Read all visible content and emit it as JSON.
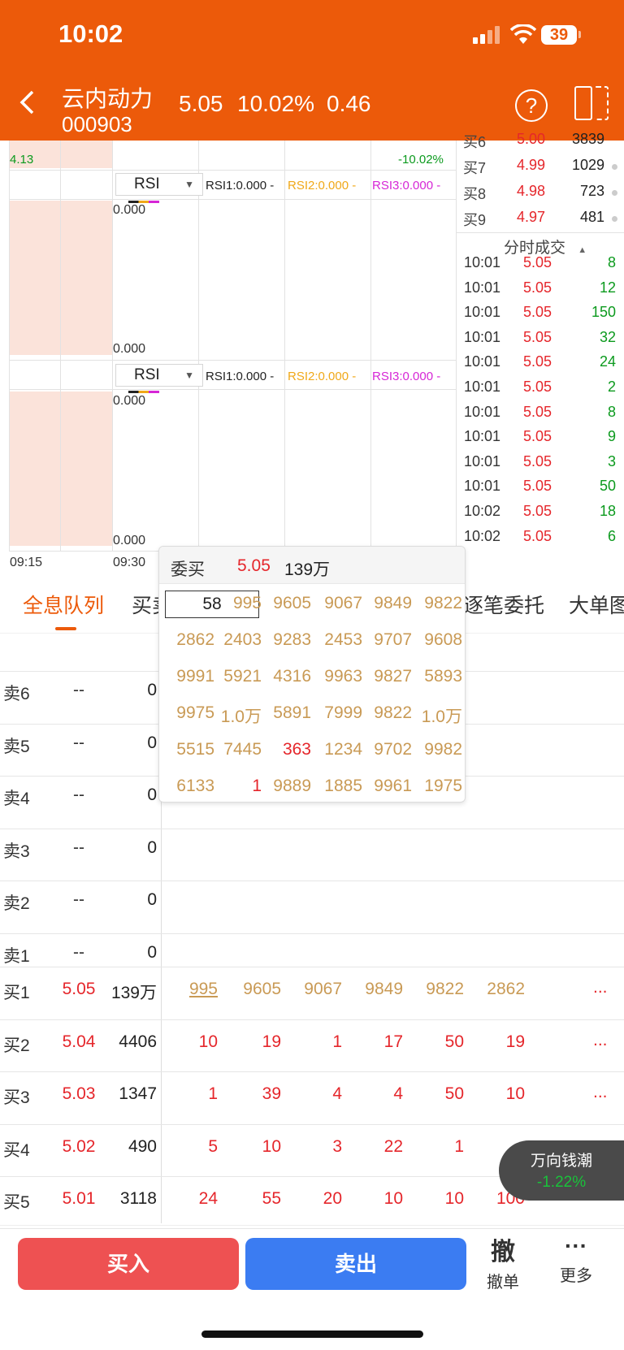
{
  "status_bar": {
    "time": "10:02",
    "battery": "39"
  },
  "header": {
    "stock_name": "云内动力",
    "stock_code": "000903",
    "price": "5.05",
    "change_pct": "10.02%",
    "change": "0.46",
    "help_icon": "?"
  },
  "chart": {
    "top_left_value": "4.13",
    "top_right_value": "-10.02%",
    "rsi_select": "RSI",
    "rsi_labels": {
      "rsi1": "RSI1:0.000 -",
      "rsi2": "RSI2:0.000 -",
      "rsi3": "RSI3:0.000 -"
    },
    "axis_top": "0.000",
    "axis_bottom": "0.000",
    "time_start": "09:15",
    "time_mid": "09:30",
    "colors": {
      "rsi1": "#222222",
      "rsi2": "#f0a818",
      "rsi3": "#d626d6"
    }
  },
  "order_book_partial": [
    {
      "label": "买6",
      "price": "5.00",
      "volume": "3839"
    },
    {
      "label": "买7",
      "price": "4.99",
      "volume": "1029"
    },
    {
      "label": "买8",
      "price": "4.98",
      "volume": "723"
    },
    {
      "label": "买9",
      "price": "4.97",
      "volume": "481"
    }
  ],
  "trades": {
    "title": "分时成交",
    "rows": [
      {
        "time": "10:01",
        "price": "5.05",
        "vol": "8"
      },
      {
        "time": "10:01",
        "price": "5.05",
        "vol": "12"
      },
      {
        "time": "10:01",
        "price": "5.05",
        "vol": "150"
      },
      {
        "time": "10:01",
        "price": "5.05",
        "vol": "32"
      },
      {
        "time": "10:01",
        "price": "5.05",
        "vol": "24"
      },
      {
        "time": "10:01",
        "price": "5.05",
        "vol": "2"
      },
      {
        "time": "10:01",
        "price": "5.05",
        "vol": "8"
      },
      {
        "time": "10:01",
        "price": "5.05",
        "vol": "9"
      },
      {
        "time": "10:01",
        "price": "5.05",
        "vol": "3"
      },
      {
        "time": "10:01",
        "price": "5.05",
        "vol": "50"
      },
      {
        "time": "10:02",
        "price": "5.05",
        "vol": "18"
      },
      {
        "time": "10:02",
        "price": "5.05",
        "vol": "6"
      }
    ]
  },
  "tabs": {
    "full_queue": "全息队列",
    "buy_partial": "买卖",
    "tick_orders": "逐笔委托",
    "big_orders": "大单图"
  },
  "sell_rows": [
    {
      "label": "卖6",
      "price": "--",
      "volume": "0"
    },
    {
      "label": "卖5",
      "price": "--",
      "volume": "0"
    },
    {
      "label": "卖4",
      "price": "--",
      "volume": "0"
    },
    {
      "label": "卖3",
      "price": "--",
      "volume": "0"
    },
    {
      "label": "卖2",
      "price": "--",
      "volume": "0"
    },
    {
      "label": "卖1",
      "price": "--",
      "volume": "0"
    }
  ],
  "buy_rows": [
    {
      "label": "买1",
      "price": "5.05",
      "volume": "139万",
      "queue": [
        "995",
        "9605",
        "9067",
        "9849",
        "9822",
        "2862"
      ],
      "more": "..."
    },
    {
      "label": "买2",
      "price": "5.04",
      "volume": "4406",
      "queue": [
        "10",
        "19",
        "1",
        "17",
        "50",
        "19"
      ],
      "more": "..."
    },
    {
      "label": "买3",
      "price": "5.03",
      "volume": "1347",
      "queue": [
        "1",
        "39",
        "4",
        "4",
        "50",
        "10"
      ],
      "more": "..."
    },
    {
      "label": "买4",
      "price": "5.02",
      "volume": "490",
      "queue": [
        "5",
        "10",
        "3",
        "22",
        "1",
        ""
      ],
      "more": ""
    },
    {
      "label": "买5",
      "price": "5.01",
      "volume": "3118",
      "queue": [
        "24",
        "55",
        "20",
        "10",
        "10",
        "100"
      ],
      "more": ""
    }
  ],
  "popup": {
    "title": "委买",
    "price": "5.05",
    "volume": "139万",
    "input_value": "58",
    "grid": [
      [
        "",
        "995",
        "9605",
        "9067",
        "9849",
        "9822"
      ],
      [
        "2862",
        "2403",
        "9283",
        "2453",
        "9707",
        "9608"
      ],
      [
        "9991",
        "5921",
        "4316",
        "9963",
        "9827",
        "5893"
      ],
      [
        "9975",
        "1.0万",
        "5891",
        "7999",
        "9822",
        "1.0万"
      ],
      [
        "5515",
        "7445",
        "363",
        "1234",
        "9702",
        "9982"
      ],
      [
        "6133",
        "1",
        "9889",
        "1885",
        "9961",
        "1975"
      ]
    ]
  },
  "float_badge": {
    "name": "万向钱潮",
    "change": "-1.22%"
  },
  "bottom": {
    "buy": "买入",
    "sell": "卖出",
    "cancel_icon": "撤",
    "cancel": "撤单",
    "more_icon": "···",
    "more": "更多"
  }
}
